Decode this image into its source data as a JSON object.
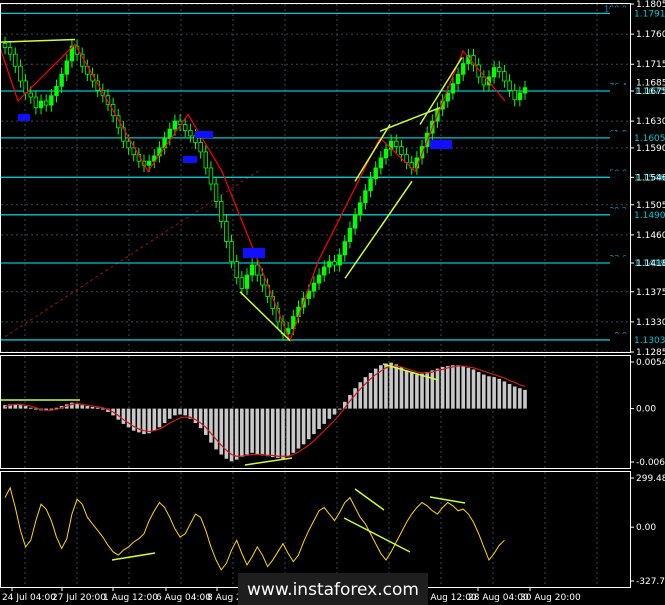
{
  "chart_data": [
    {
      "type": "candlestick",
      "panel": "price",
      "ylim": [
        1.1285,
        1.1805
      ],
      "y_ticks": [
        "1.1805",
        "1.1760",
        "1.1715",
        "1.1675",
        "1.1630",
        "1.1590",
        "1.1546",
        "1.1505",
        "1.1460",
        "1.1418",
        "1.1375",
        "1.1330",
        "1.1285"
      ],
      "fib_levels": [
        {
          "label": "100.0",
          "value": 1.1791,
          "value_label": "1.1791"
        },
        {
          "label": "76.4",
          "value": 1.1675,
          "value_label": "1.1675"
        },
        {
          "label": "61.8",
          "value": 1.1605,
          "value_label": "1.1605"
        },
        {
          "label": "50.0",
          "value": 1.1546,
          "value_label": "1.1546"
        },
        {
          "label": "38.2",
          "value": 1.149,
          "value_label": "1.1490"
        },
        {
          "label": "23.6",
          "value": 1.1418,
          "value_label": "1.1418"
        },
        {
          "label": "0.0",
          "value": 1.1303,
          "value_label": "1.1303"
        }
      ],
      "extra_price_label": "1.1685",
      "zigzag": [
        [
          0,
          1.174
        ],
        [
          18,
          1.166
        ],
        [
          75,
          1.1745
        ],
        [
          148,
          1.1555
        ],
        [
          188,
          1.164
        ],
        [
          222,
          1.1555
        ],
        [
          290,
          1.1302
        ],
        [
          318,
          1.142
        ],
        [
          380,
          1.1605
        ],
        [
          415,
          1.1555
        ],
        [
          463,
          1.1735
        ],
        [
          505,
          1.166
        ]
      ],
      "channels": [
        [
          [
            0,
            1.1748
          ],
          [
            75,
            1.1752
          ]
        ],
        [
          [
            290,
            1.1302
          ],
          [
            240,
            1.1375
          ]
        ],
        [
          [
            345,
            1.1395
          ],
          [
            412,
            1.154
          ]
        ],
        [
          [
            380,
            1.1615
          ],
          [
            440,
            1.165
          ]
        ],
        [
          [
            355,
            1.154
          ],
          [
            390,
            1.1625
          ]
        ],
        [
          [
            420,
            1.1625
          ],
          [
            462,
            1.1725
          ]
        ]
      ],
      "close": [
        1.174,
        1.173,
        1.1712,
        1.169,
        1.1672,
        1.1666,
        1.165,
        1.166,
        1.1654,
        1.1668,
        1.1682,
        1.17,
        1.172,
        1.1742,
        1.173,
        1.1712,
        1.17,
        1.169,
        1.1676,
        1.1668,
        1.1655,
        1.1638,
        1.162,
        1.16,
        1.159,
        1.158,
        1.157,
        1.1564,
        1.157,
        1.1578,
        1.159,
        1.1604,
        1.1618,
        1.163,
        1.1625,
        1.1616,
        1.1608,
        1.1598,
        1.1584,
        1.156,
        1.1536,
        1.151,
        1.148,
        1.145,
        1.142,
        1.1396,
        1.138,
        1.14,
        1.1415,
        1.14,
        1.1385,
        1.1368,
        1.135,
        1.133,
        1.1312,
        1.132,
        1.1338,
        1.1352,
        1.1365,
        1.1376,
        1.1388,
        1.14,
        1.1412,
        1.142,
        1.1415,
        1.143,
        1.145,
        1.147,
        1.149,
        1.1508,
        1.1526,
        1.1544,
        1.156,
        1.1575,
        1.1588,
        1.16,
        1.1592,
        1.158,
        1.1568,
        1.156,
        1.1575,
        1.1592,
        1.1612,
        1.163,
        1.1648,
        1.166,
        1.1672,
        1.1686,
        1.17,
        1.1716,
        1.1728,
        1.1714,
        1.1696,
        1.1684,
        1.1696,
        1.171,
        1.1704,
        1.169,
        1.1676,
        1.1662,
        1.1672,
        1.168
      ]
    },
    {
      "type": "bar",
      "panel": "macd",
      "ylim": [
        -0.00628,
        0.00548
      ],
      "y_ticks": [
        "0.00548",
        "0.00",
        "-0.00628"
      ],
      "histogram": [
        0.0004,
        0.0005,
        0.0005,
        0.0004,
        0.0003,
        0.0001,
        -0.0001,
        -0.0002,
        -0.0002,
        -0.0001,
        0.0001,
        0.0003,
        0.0005,
        0.0007,
        0.0006,
        0.0004,
        0.0003,
        0.0002,
        0.0001,
        -0.0001,
        -0.0004,
        -0.0008,
        -0.0013,
        -0.0018,
        -0.0022,
        -0.0026,
        -0.0028,
        -0.003,
        -0.0029,
        -0.0026,
        -0.0022,
        -0.0017,
        -0.0012,
        -0.0008,
        -0.0007,
        -0.0008,
        -0.0012,
        -0.0017,
        -0.0023,
        -0.0031,
        -0.004,
        -0.0048,
        -0.0054,
        -0.0059,
        -0.0062,
        -0.006,
        -0.0057,
        -0.0054,
        -0.0052,
        -0.0054,
        -0.0055,
        -0.0056,
        -0.0057,
        -0.0058,
        -0.0059,
        -0.0056,
        -0.0052,
        -0.0047,
        -0.0042,
        -0.0036,
        -0.003,
        -0.0024,
        -0.0018,
        -0.0012,
        -0.0007,
        0.0,
        0.0008,
        0.0016,
        0.0024,
        0.0031,
        0.0037,
        0.0042,
        0.0047,
        0.0051,
        0.0053,
        0.0054,
        0.0052,
        0.0049,
        0.0045,
        0.0042,
        0.004,
        0.0041,
        0.0043,
        0.0045,
        0.0047,
        0.0049,
        0.005,
        0.0051,
        0.0051,
        0.005,
        0.0048,
        0.0046,
        0.0043,
        0.004,
        0.0038,
        0.0037,
        0.0035,
        0.0032,
        0.0029,
        0.0026,
        0.0024,
        0.0022
      ],
      "signal_line": [
        0.0002,
        0.0004,
        0.0005,
        0.0005,
        0.0004,
        0.0003,
        0.0001,
        -0.0001,
        -0.0002,
        -0.0002,
        -0.0001,
        0.0001,
        0.0003,
        0.0005,
        0.0006,
        0.0005,
        0.0004,
        0.0003,
        0.0002,
        0.0001,
        -0.0001,
        -0.0004,
        -0.0008,
        -0.0013,
        -0.0017,
        -0.0021,
        -0.0024,
        -0.0026,
        -0.0027,
        -0.0026,
        -0.0024,
        -0.0021,
        -0.0017,
        -0.0014,
        -0.0011,
        -0.001,
        -0.001,
        -0.0013,
        -0.0017,
        -0.0022,
        -0.0029,
        -0.0036,
        -0.0043,
        -0.0049,
        -0.0054,
        -0.0056,
        -0.0056,
        -0.0055,
        -0.0054,
        -0.0054,
        -0.0054,
        -0.0055,
        -0.0055,
        -0.0056,
        -0.0056,
        -0.0056,
        -0.0054,
        -0.0051,
        -0.0047,
        -0.0043,
        -0.0038,
        -0.0032,
        -0.0026,
        -0.002,
        -0.0014,
        -0.0007,
        0.0001,
        0.0009,
        0.0016,
        0.0023,
        0.0029,
        0.0035,
        0.004,
        0.0044,
        0.0048,
        0.005,
        0.005,
        0.0049,
        0.0047,
        0.0045,
        0.0043,
        0.0042,
        0.0042,
        0.0043,
        0.0045,
        0.0046,
        0.0048,
        0.0049,
        0.005,
        0.005,
        0.0049,
        0.0048,
        0.0046,
        0.0044,
        0.0042,
        0.004,
        0.0038,
        0.0036,
        0.0033,
        0.0031,
        0.0028,
        0.0026
      ]
    },
    {
      "type": "line",
      "panel": "oscillator",
      "ylim": [
        -327.725,
        299.482
      ],
      "y_ticks": [
        "299.482",
        "0.00",
        "-327.725"
      ],
      "values": [
        180,
        240,
        120,
        -20,
        -120,
        -80,
        40,
        140,
        110,
        40,
        -60,
        -130,
        -70,
        80,
        170,
        140,
        60,
        20,
        -20,
        -60,
        -110,
        -150,
        -170,
        -140,
        -120,
        -90,
        -70,
        -40,
        40,
        100,
        150,
        120,
        60,
        -10,
        -60,
        -40,
        20,
        80,
        60,
        -20,
        -120,
        -200,
        -260,
        -220,
        -140,
        -80,
        -160,
        -230,
        -180,
        -120,
        -170,
        -240,
        -200,
        -150,
        -100,
        -160,
        -210,
        -170,
        -90,
        -20,
        40,
        100,
        120,
        80,
        40,
        90,
        150,
        180,
        120,
        60,
        20,
        -40,
        -100,
        -160,
        -200,
        -150,
        -90,
        -30,
        30,
        80,
        120,
        150,
        130,
        100,
        80,
        120,
        150,
        130,
        100,
        110,
        80,
        30,
        -40,
        -120,
        -200,
        -160,
        -110,
        -80
      ]
    }
  ],
  "x_axis_labels": [
    "24 Jul 04:00",
    "27 Jul 20:00",
    "1 Aug 12:00",
    "6 Aug 04:00",
    "8 Aug 20:00",
    "13 Aug 12:00",
    "16 Aug 04:00",
    "20 Aug 20:00",
    "23 Aug 12:00",
    "28 Aug 04:00",
    "30 Aug 20:00"
  ],
  "watermark": "www.instaforex.com",
  "colors": {
    "background": "#000000",
    "grid": "#3a4650",
    "frame": "#ffffff",
    "fib_line": "#00c8d2",
    "fib_text": "#1e8cc8",
    "bull_candle": "#00ff00",
    "trend_line": "#ff0000",
    "channel_line": "#ccff33",
    "histogram": "#c8c8c8",
    "signal": "#d01818",
    "oscillator": "#ffd700",
    "highlight": "#1010ff",
    "text": "#ffffff",
    "watermark_bg": "#1e1e1e"
  }
}
